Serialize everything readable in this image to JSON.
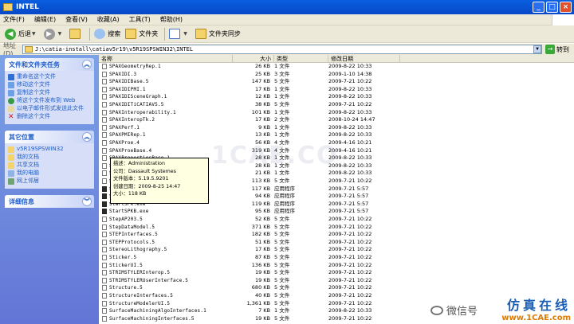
{
  "window": {
    "title": "INTEL"
  },
  "menu": [
    "文件(F)",
    "编辑(E)",
    "查看(V)",
    "收藏(A)",
    "工具(T)",
    "帮助(H)"
  ],
  "toolbar": {
    "back": "后退",
    "search": "搜索",
    "folders": "文件夹",
    "sync": "文件夹同步"
  },
  "address": {
    "label": "地址(D)",
    "path": "J:\\catia-install\\catiav5r19\\v5R19SPSWIN32\\INTEL",
    "go": "转到"
  },
  "tasks": {
    "title": "文件和文件夹任务",
    "items": [
      "重命名这个文件",
      "移动这个文件",
      "复制这个文件",
      "将这个文件发布到 Web",
      "以电子邮件形式发送此文件",
      "删除这个文件"
    ]
  },
  "places": {
    "title": "其它位置",
    "items": [
      "v5R19SPSWIN32",
      "我的文档",
      "共享文档",
      "我的电脑",
      "网上邻居"
    ]
  },
  "details": {
    "title": "详细信息"
  },
  "columns": {
    "name": "名称",
    "size": "大小",
    "type": "类型",
    "modified": "修改日期"
  },
  "files": [
    {
      "name": "SPAXGeometryRep.1",
      "size": "26 KB",
      "type": "1 文件",
      "date": "2009-8-22 10:33",
      "exe": false
    },
    {
      "name": "SPAXIDI.3",
      "size": "25 KB",
      "type": "3 文件",
      "date": "2009-1-10 14:38",
      "exe": false
    },
    {
      "name": "SPAXIDIBase.5",
      "size": "147 KB",
      "type": "5 文件",
      "date": "2009-7-21 10:22",
      "exe": false
    },
    {
      "name": "SPAXIDIPMI.1",
      "size": "17 KB",
      "type": "1 文件",
      "date": "2009-8-22 10:33",
      "exe": false
    },
    {
      "name": "SPAXIDISceneGraph.1",
      "size": "12 KB",
      "type": "1 文件",
      "date": "2009-8-22 10:33",
      "exe": false
    },
    {
      "name": "SPAXIDITiCATIAV5.5",
      "size": "38 KB",
      "type": "5 文件",
      "date": "2009-7-21 10:22",
      "exe": false
    },
    {
      "name": "SPAXInteroperability.1",
      "size": "101 KB",
      "type": "1 文件",
      "date": "2009-8-22 10:33",
      "exe": false
    },
    {
      "name": "SPAXInteropTk.2",
      "size": "17 KB",
      "type": "2 文件",
      "date": "2008-10-24 14:47",
      "exe": false
    },
    {
      "name": "SPAXPerf.1",
      "size": "9 KB",
      "type": "1 文件",
      "date": "2009-8-22 10:33",
      "exe": false
    },
    {
      "name": "SPAXPMIRep.1",
      "size": "13 KB",
      "type": "1 文件",
      "date": "2009-8-22 10:33",
      "exe": false
    },
    {
      "name": "SPAXProe.4",
      "size": "56 KB",
      "type": "4 文件",
      "date": "2009-4-16 10:21",
      "exe": false
    },
    {
      "name": "SPAXProeBase.4",
      "size": "319 KB",
      "type": "4 文件",
      "date": "2009-4-16 10:21",
      "exe": false
    },
    {
      "name": "SPAXPropertiesBase.1",
      "size": "28 KB",
      "type": "1 文件",
      "date": "2009-8-22 10:33",
      "exe": false
    },
    {
      "name": "SPAXProxyInteroperability.1",
      "size": "28 KB",
      "type": "1 文件",
      "date": "2009-8-22 10:33",
      "exe": false
    },
    {
      "name": "SPAXSceneGraphRep.1",
      "size": "21 KB",
      "type": "1 文件",
      "date": "2009-8-22 10:33",
      "exe": false
    },
    {
      "name": "SPAXV5Tk.5",
      "size": "113 KB",
      "type": "5 文件",
      "date": "2009-7-21 10:22",
      "exe": false
    },
    {
      "name": "StartSAT.exe",
      "size": "117 KB",
      "type": "应用程序",
      "date": "2009-7-21 5:57",
      "exe": true
    },
    {
      "name": "StartSATB.exe",
      "size": "94 KB",
      "type": "应用程序",
      "date": "2009-7-21 5:57",
      "exe": true
    },
    {
      "name": "StartSPK.exe",
      "size": "119 KB",
      "type": "应用程序",
      "date": "2009-7-21 5:57",
      "exe": true
    },
    {
      "name": "StartSPKB.exe",
      "size": "95 KB",
      "type": "应用程序",
      "date": "2009-7-21 5:57",
      "exe": true
    },
    {
      "name": "StepAP203.5",
      "size": "52 KB",
      "type": "5 文件",
      "date": "2009-7-21 10:22",
      "exe": false
    },
    {
      "name": "StepDataModel.5",
      "size": "371 KB",
      "type": "5 文件",
      "date": "2009-7-21 10:22",
      "exe": false
    },
    {
      "name": "STEPInterfaces.5",
      "size": "182 KB",
      "type": "5 文件",
      "date": "2009-7-21 10:22",
      "exe": false
    },
    {
      "name": "STEPProtocols.5",
      "size": "51 KB",
      "type": "5 文件",
      "date": "2009-7-21 10:22",
      "exe": false
    },
    {
      "name": "StereoLithography.5",
      "size": "17 KB",
      "type": "5 文件",
      "date": "2009-7-21 10:22",
      "exe": false
    },
    {
      "name": "Sticker.5",
      "size": "87 KB",
      "type": "5 文件",
      "date": "2009-7-21 10:22",
      "exe": false
    },
    {
      "name": "StickerUI.5",
      "size": "136 KB",
      "type": "5 文件",
      "date": "2009-7-21 10:22",
      "exe": false
    },
    {
      "name": "STRIMSTYLERInterop.5",
      "size": "19 KB",
      "type": "5 文件",
      "date": "2009-7-21 10:22",
      "exe": false
    },
    {
      "name": "STRIMSTYLERUserInterface.5",
      "size": "19 KB",
      "type": "5 文件",
      "date": "2009-7-21 10:22",
      "exe": false
    },
    {
      "name": "Structure.5",
      "size": "680 KB",
      "type": "5 文件",
      "date": "2009-7-21 10:22",
      "exe": false
    },
    {
      "name": "StructureInterfaces.5",
      "size": "40 KB",
      "type": "5 文件",
      "date": "2009-7-21 10:22",
      "exe": false
    },
    {
      "name": "StructureModelerUI.5",
      "size": "1,361 KB",
      "type": "5 文件",
      "date": "2009-7-21 10:22",
      "exe": false
    },
    {
      "name": "SurfaceMachiningAlgoInterfaces.1",
      "size": "7 KB",
      "type": "1 文件",
      "date": "2009-8-22 10:33",
      "exe": false
    },
    {
      "name": "SurfaceMachiningInterfaces.5",
      "size": "19 KB",
      "type": "5 文件",
      "date": "2009-7-21 10:22",
      "exe": false
    }
  ],
  "tooltip": {
    "desc": "描述：Administration",
    "company": "公司：Dassault Systemes",
    "version": "文件版本：5.19.5.9201",
    "created": "创建日期：2009-8-25 14:47",
    "size": "大小：118 KB"
  },
  "branding": {
    "watermark": "1CAE.CO",
    "wechat": "微信号",
    "cn": "仿真在线",
    "en": "www.1CAE.com"
  }
}
